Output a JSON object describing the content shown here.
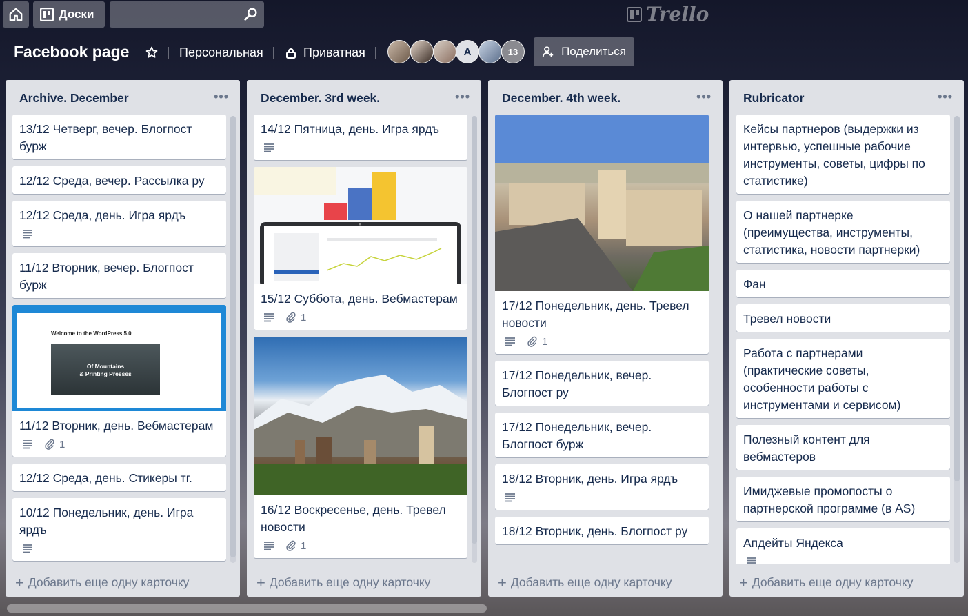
{
  "topbar": {
    "boards_label": "Доски",
    "search_value": "",
    "logo_text": "Trello"
  },
  "board": {
    "title": "Facebook page",
    "team": "Персональная",
    "visibility": "Приватная",
    "member_letter_avatar": "A",
    "members_more": "13",
    "share_label": "Поделиться"
  },
  "add_card_label": "Добавить еще одну карточку",
  "lists": [
    {
      "title": "Archive. December",
      "cards": [
        {
          "text": "13/12 Четверг, вечер. Блогпост бурж"
        },
        {
          "text": "12/12 Среда, вечер. Рассылка ру"
        },
        {
          "text": "12/12 Среда, день. Игра ярдъ",
          "description": true
        },
        {
          "text": "11/12 Вторник, вечер. Блогпост бурж"
        },
        {
          "text": "11/12 Вторник, день. Вебмастерам",
          "cover": "wp",
          "description": true,
          "attachments": "1",
          "cover_title": "Welcome to the WordPress 5.0",
          "cover_caption_1": "Of Mountains",
          "cover_caption_2": "& Printing Presses"
        },
        {
          "text": "12/12 Среда, день. Стикеры тг."
        },
        {
          "text": "10/12 Понедельник, день. Игра ярдъ",
          "description": true
        }
      ]
    },
    {
      "title": "December. 3rd week.",
      "cards": [
        {
          "text": "14/12 Пятница, день. Игра ярдъ",
          "description": true
        },
        {
          "text": "15/12 Суббота, день. Вебмастерам",
          "cover": "chart",
          "description": true,
          "attachments": "1"
        },
        {
          "text": "16/12 Воскресенье, день. Тревел новости",
          "cover": "mountain",
          "description": true,
          "attachments": "1"
        }
      ]
    },
    {
      "title": "December. 4th week.",
      "cards": [
        {
          "text": "17/12 Понедельник, день. Тревел новости",
          "cover": "city",
          "description": true,
          "attachments": "1"
        },
        {
          "text": "17/12 Понедельник, вечер. Блогпост ру"
        },
        {
          "text": "17/12 Понедельник, вечер. Блогпост бурж"
        },
        {
          "text": "18/12 Вторник, день. Игра ярдъ",
          "description": true
        },
        {
          "text": "18/12 Вторник, день. Блогпост ру"
        }
      ]
    },
    {
      "title": "Rubricator",
      "cards": [
        {
          "text": "Кейсы партнеров (выдержки из интервью, успешные рабочие инструменты, советы, цифры по статистике)"
        },
        {
          "text": "О нашей партнерке (преимущества, инструменты, статистика, новости партнерки)"
        },
        {
          "text": "Фан"
        },
        {
          "text": "Тревел новости"
        },
        {
          "text": "Работа с партнерами (практические советы, особенности работы с инструментами и сервисом)"
        },
        {
          "text": "Полезный контент для вебмастеров"
        },
        {
          "text": "Имиджевые промопосты о партнерской программе (в AS)"
        },
        {
          "text": "Апдейты Яндекса",
          "description": true
        }
      ]
    }
  ],
  "colors": {
    "list_bg": "#dfe1e6",
    "card_bg": "#ffffff",
    "text": "#172b4d",
    "muted": "#6b778c"
  },
  "icons": [
    "home-icon",
    "boards-icon",
    "search-icon",
    "star-icon",
    "lock-icon",
    "share-user-icon",
    "description-icon",
    "attachment-icon",
    "more-icon",
    "plus-icon"
  ]
}
